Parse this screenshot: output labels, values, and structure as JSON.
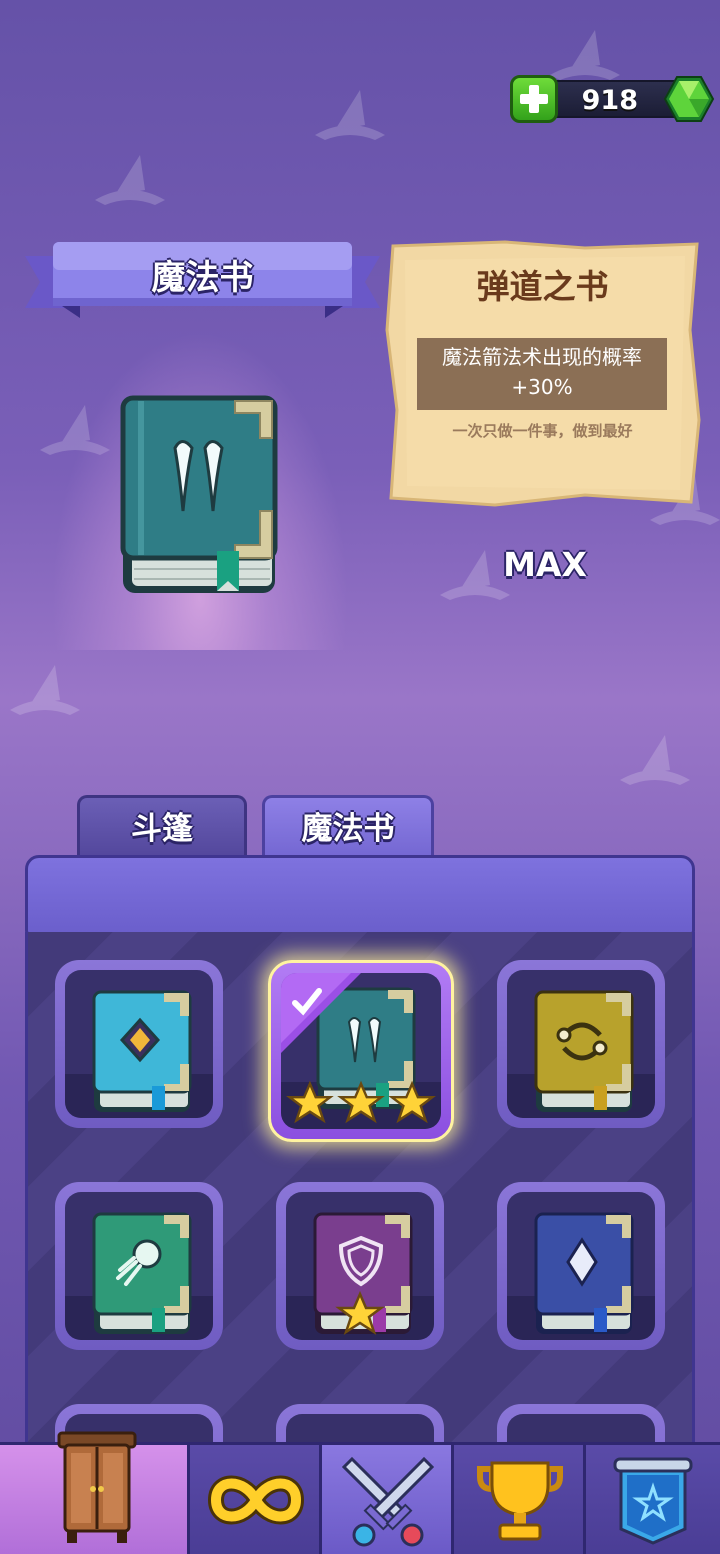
{
  "currency": {
    "gems": "918",
    "add_icon": "plus-icon",
    "gem_icon": "green-gem-icon"
  },
  "header": {
    "title": "魔法书"
  },
  "detail": {
    "name": "弹道之书",
    "effect_line1": "魔法箭法术出现的概率",
    "effect_line2": "+30%",
    "flavor": "一次只做一件事，做到最好",
    "level": "MAX"
  },
  "tabs": [
    {
      "label": "斗篷"
    },
    {
      "label": "魔法书"
    }
  ],
  "books": [
    {
      "name": "diamond-book",
      "color": "#3fb7d8",
      "stars": 0,
      "selected": false
    },
    {
      "name": "arrows-book",
      "color": "#2f7d86",
      "stars": 3,
      "selected": true
    },
    {
      "name": "swap-book",
      "color": "#b8a22c",
      "stars": 0,
      "selected": false
    },
    {
      "name": "comet-book",
      "color": "#2f9a78",
      "stars": 0,
      "selected": false
    },
    {
      "name": "shield-book",
      "color": "#7a3e8e",
      "stars": 1,
      "selected": false
    },
    {
      "name": "crystal-book",
      "color": "#3a4fa6",
      "stars": 0,
      "selected": false
    }
  ],
  "nav": [
    {
      "name": "wardrobe-icon",
      "active": true
    },
    {
      "name": "infinity-icon",
      "active": false
    },
    {
      "name": "crossed-swords-icon",
      "active": false
    },
    {
      "name": "trophy-icon",
      "active": false
    },
    {
      "name": "banner-icon",
      "active": false
    }
  ]
}
